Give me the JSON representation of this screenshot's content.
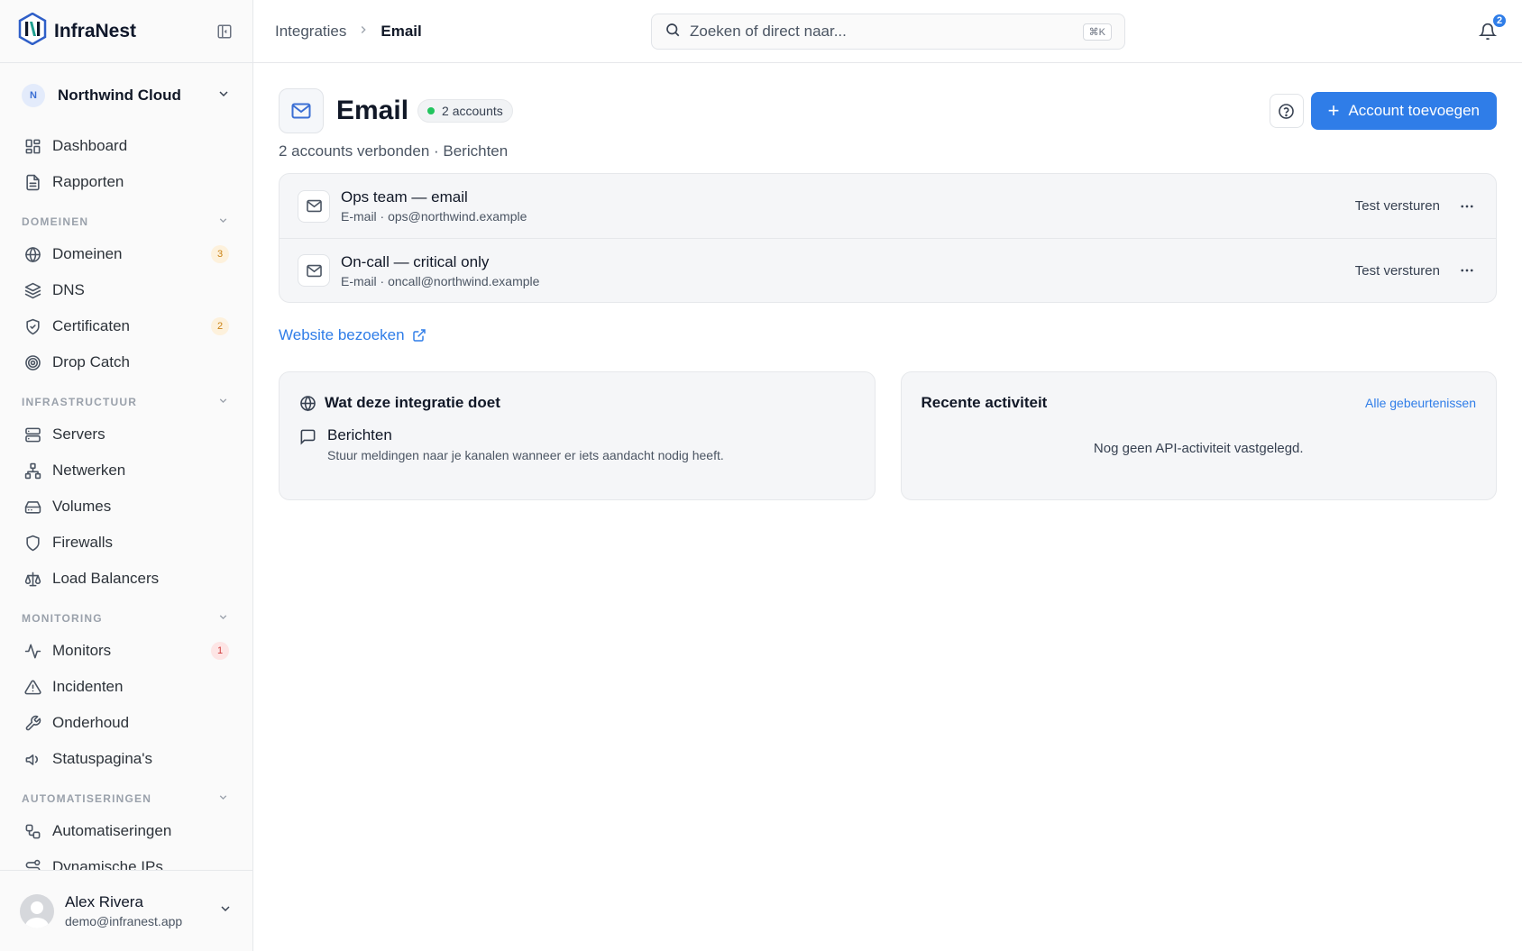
{
  "brand": {
    "name": "InfraNest"
  },
  "org": {
    "initial": "N",
    "name": "Northwind Cloud"
  },
  "nav": {
    "top": [
      {
        "label": "Dashboard",
        "icon": "dashboard-icon"
      },
      {
        "label": "Rapporten",
        "icon": "report-icon"
      }
    ],
    "sections": [
      {
        "title": "DOMEINEN",
        "items": [
          {
            "label": "Domeinen",
            "icon": "globe-icon",
            "badge": "3",
            "badge_color": "orange"
          },
          {
            "label": "DNS",
            "icon": "layers-icon"
          },
          {
            "label": "Certificaten",
            "icon": "shield-check-icon",
            "badge": "2",
            "badge_color": "orange"
          },
          {
            "label": "Drop Catch",
            "icon": "target-icon"
          }
        ]
      },
      {
        "title": "INFRASTRUCTUUR",
        "items": [
          {
            "label": "Servers",
            "icon": "server-icon"
          },
          {
            "label": "Netwerken",
            "icon": "network-icon"
          },
          {
            "label": "Volumes",
            "icon": "hard-drive-icon"
          },
          {
            "label": "Firewalls",
            "icon": "shield-icon"
          },
          {
            "label": "Load Balancers",
            "icon": "scale-icon"
          }
        ]
      },
      {
        "title": "MONITORING",
        "items": [
          {
            "label": "Monitors",
            "icon": "activity-icon",
            "badge": "1",
            "badge_color": "red"
          },
          {
            "label": "Incidenten",
            "icon": "alert-triangle-icon"
          },
          {
            "label": "Onderhoud",
            "icon": "wrench-icon"
          },
          {
            "label": "Statuspagina's",
            "icon": "megaphone-icon"
          }
        ]
      },
      {
        "title": "AUTOMATISERINGEN",
        "items": [
          {
            "label": "Automatiseringen",
            "icon": "workflow-icon"
          },
          {
            "label": "Dynamische IPs",
            "icon": "route-icon"
          }
        ]
      }
    ]
  },
  "user": {
    "name": "Alex Rivera",
    "email": "demo@infranest.app"
  },
  "topbar": {
    "breadcrumb": {
      "parent": "Integraties",
      "current": "Email"
    },
    "search": {
      "placeholder": "Zoeken of direct naar...",
      "shortcut": "⌘K"
    },
    "notifications": "2"
  },
  "page": {
    "title": "Email",
    "pill": "2 accounts",
    "add_button": "Account toevoegen",
    "subtitle": "2 accounts verbonden · Berichten",
    "accounts": [
      {
        "name": "Ops team — email",
        "meta": "E-mail · ops@northwind.example",
        "action": "Test versturen"
      },
      {
        "name": "On-call — critical only",
        "meta": "E-mail · oncall@northwind.example",
        "action": "Test versturen"
      }
    ],
    "visit_link": "Website bezoeken",
    "about": {
      "title": "Wat deze integratie doet",
      "feature_name": "Berichten",
      "feature_desc": "Stuur meldingen naar je kanalen wanneer er iets aandacht nodig heeft."
    },
    "activity": {
      "title": "Recente activiteit",
      "link": "Alle gebeurtenissen",
      "empty": "Nog geen API-activiteit vastgelegd."
    }
  },
  "colors": {
    "accent": "#2f7de8",
    "status_ok": "#22c55e"
  }
}
